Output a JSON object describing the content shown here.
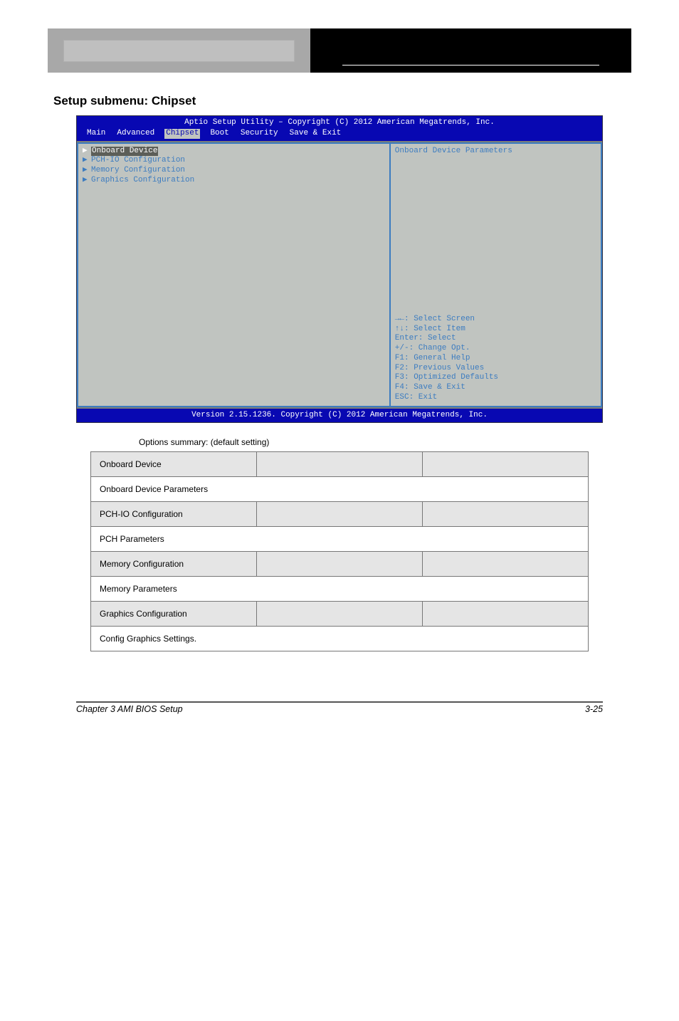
{
  "section_title": "Setup submenu: Chipset",
  "bios": {
    "title": "Aptio Setup Utility – Copyright (C) 2012 American Megatrends, Inc.",
    "tabs": [
      "Main",
      "Advanced",
      "Chipset",
      "Boot",
      "Security",
      "Save & Exit"
    ],
    "active_tab": "Chipset",
    "menu_items": [
      {
        "label": "Onboard Device",
        "selected": true
      },
      {
        "label": "PCH-IO Configuration",
        "selected": false
      },
      {
        "label": "Memory Configuration",
        "selected": false
      },
      {
        "label": "Graphics Configuration",
        "selected": false
      }
    ],
    "side_description": "Onboard Device Parameters",
    "help_lines": [
      "→←: Select Screen",
      "↑↓: Select Item",
      "Enter: Select",
      "+/-: Change Opt.",
      "F1: General Help",
      "F2: Previous Values",
      "F3: Optimized Defaults",
      "F4: Save & Exit",
      "ESC: Exit"
    ],
    "footer": "Version 2.15.1236. Copyright (C) 2012 American Megatrends, Inc."
  },
  "table": {
    "columns": [
      "",
      "",
      ""
    ],
    "rows": [
      {
        "opt_label": "Options summary: (default setting)",
        "item_hdr": "Onboard Device",
        "item_val": "Onboard Device Parameters"
      },
      {
        "item_hdr": "PCH-IO Configuration",
        "item_val": "PCH Parameters"
      },
      {
        "item_hdr": "Memory Configuration",
        "item_val": "Memory Parameters"
      },
      {
        "item_hdr": "Graphics Configuration",
        "item_val": "Config Graphics Settings."
      }
    ]
  },
  "footer": {
    "left": "Chapter 3 AMI BIOS Setup",
    "right": "3-25"
  }
}
